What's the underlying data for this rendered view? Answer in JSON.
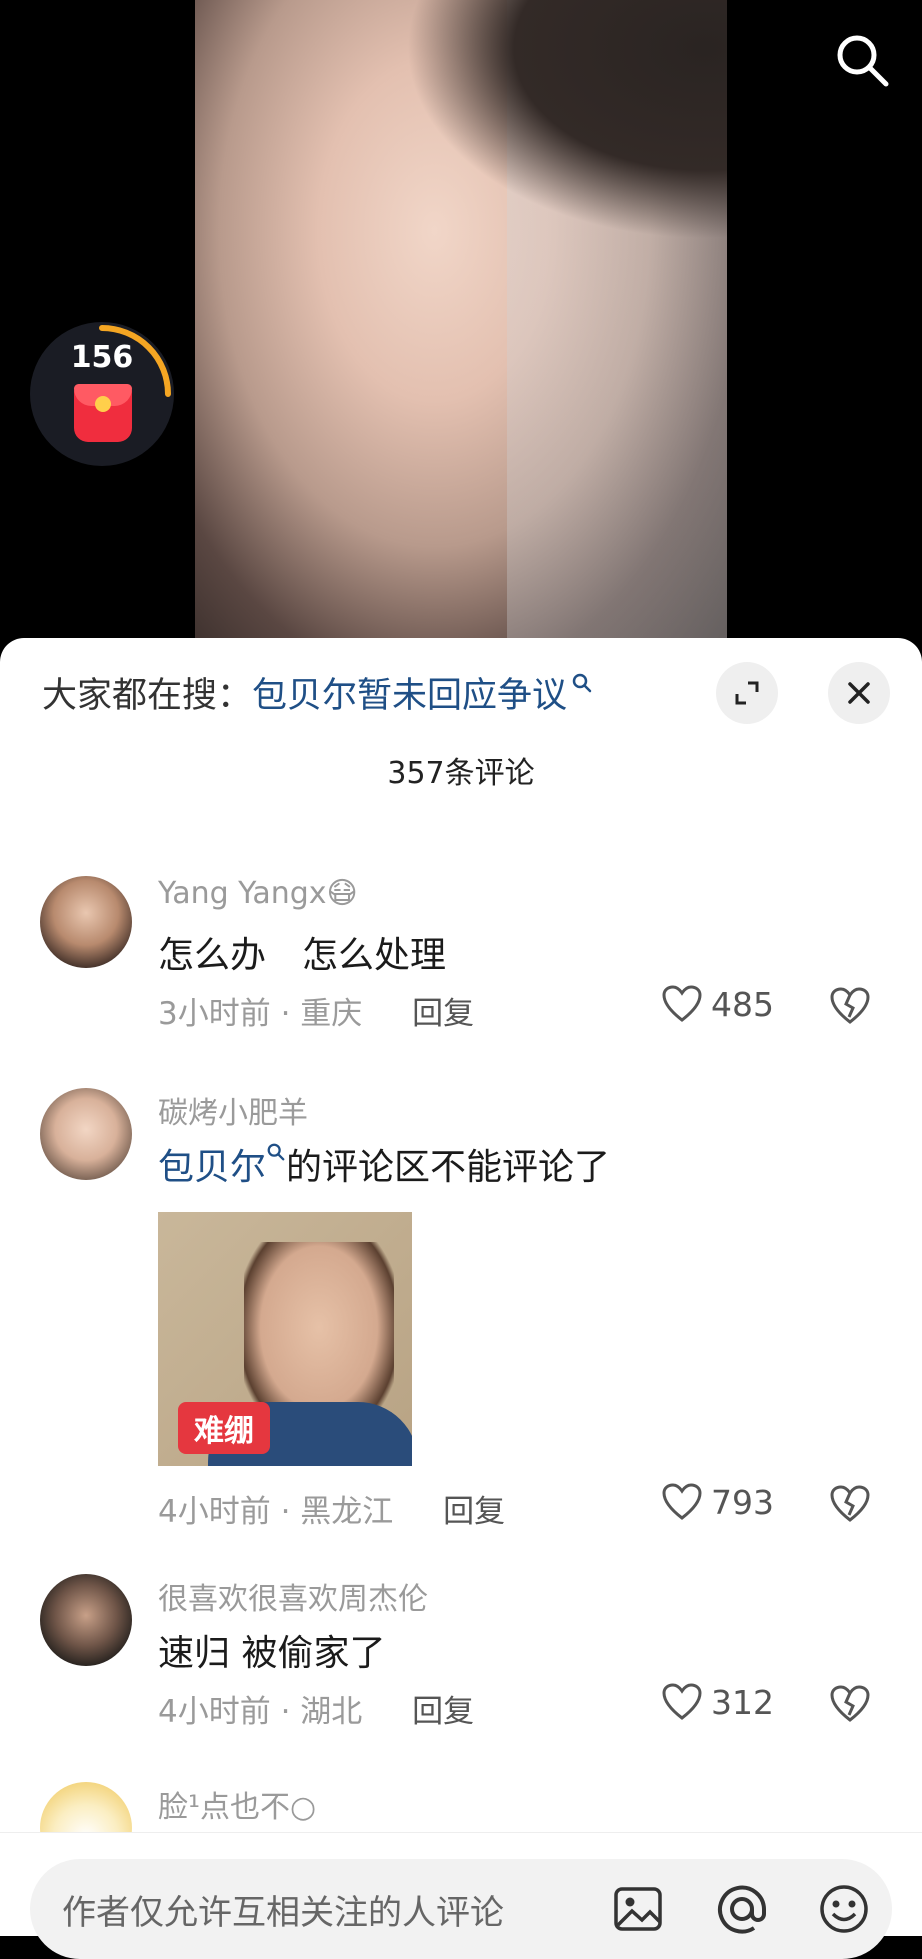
{
  "redpacket": {
    "count": "156"
  },
  "hot_search": {
    "label": "大家都在搜：",
    "term": "包贝尔暂未回应争议",
    "icon": "search-icon"
  },
  "comments_title": "357条评论",
  "comments": [
    {
      "username": "Yang Yangx😷",
      "text": "怎么办　怎么处理",
      "time": "3小时前 · 重庆",
      "reply": "回复",
      "likes": "485"
    },
    {
      "username": "碳烤小肥羊",
      "mention": "包贝尔",
      "text": "的评论区不能评论了",
      "meme_tag": "难绷",
      "time": "4小时前 · 黑龙江",
      "reply": "回复",
      "likes": "793"
    },
    {
      "username": "很喜欢很喜欢周杰伦",
      "text": "速归 被偷家了",
      "time": "4小时前 · 湖北",
      "reply": "回复",
      "likes": "312"
    },
    {
      "username": "脸¹点也不○"
    }
  ],
  "input": {
    "placeholder": "作者仅允许互相关注的人评论"
  },
  "colors": {
    "accent_link": "#1f4f86",
    "sheet_bg": "#ffffff",
    "redpacket": "#f02d3e"
  }
}
